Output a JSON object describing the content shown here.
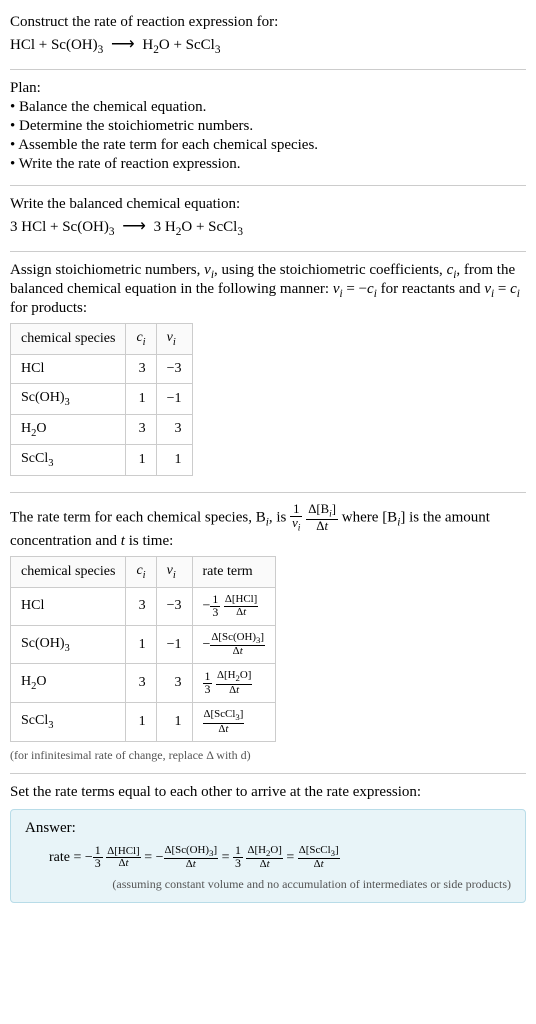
{
  "header": {
    "prompt": "Construct the rate of reaction expression for:",
    "equation": "HCl + Sc(OH)₃  ⟶  H₂O + ScCl₃"
  },
  "plan": {
    "title": "Plan:",
    "items": [
      "Balance the chemical equation.",
      "Determine the stoichiometric numbers.",
      "Assemble the rate term for each chemical species.",
      "Write the rate of reaction expression."
    ]
  },
  "balanced": {
    "prompt": "Write the balanced chemical equation:",
    "equation": "3 HCl + Sc(OH)₃  ⟶  3 H₂O + ScCl₃"
  },
  "stoich": {
    "intro_a": "Assign stoichiometric numbers, ",
    "intro_b": ", using the stoichiometric coefficients, ",
    "intro_c": ", from the balanced chemical equation in the following manner: ",
    "intro_d": " for reactants and ",
    "intro_e": " for products:",
    "headers": {
      "species": "chemical species",
      "ci": "cᵢ",
      "vi": "νᵢ"
    },
    "rows": [
      {
        "species": "HCl",
        "ci": "3",
        "vi": "−3"
      },
      {
        "species": "Sc(OH)₃",
        "ci": "1",
        "vi": "−1"
      },
      {
        "species": "H₂O",
        "ci": "3",
        "vi": "3"
      },
      {
        "species": "ScCl₃",
        "ci": "1",
        "vi": "1"
      }
    ]
  },
  "rateterm": {
    "intro_a": "The rate term for each chemical species, B",
    "intro_b": ", is ",
    "intro_c": " where [B",
    "intro_d": "] is the amount concentration and ",
    "intro_e": " is time:",
    "headers": {
      "species": "chemical species",
      "ci": "cᵢ",
      "vi": "νᵢ",
      "rate": "rate term"
    },
    "rows": [
      {
        "species": "HCl",
        "ci": "3",
        "vi": "−3",
        "coef_sign": "−",
        "coef_num": "1",
        "coef_den": "3",
        "conc": "Δ[HCl]"
      },
      {
        "species": "Sc(OH)₃",
        "ci": "1",
        "vi": "−1",
        "coef_sign": "−",
        "coef_num": "",
        "coef_den": "",
        "conc": "Δ[Sc(OH)3]"
      },
      {
        "species": "H₂O",
        "ci": "3",
        "vi": "3",
        "coef_sign": "",
        "coef_num": "1",
        "coef_den": "3",
        "conc": "Δ[H2O]"
      },
      {
        "species": "ScCl₃",
        "ci": "1",
        "vi": "1",
        "coef_sign": "",
        "coef_num": "",
        "coef_den": "",
        "conc": "Δ[ScCl3]"
      }
    ],
    "note": "(for infinitesimal rate of change, replace Δ with d)"
  },
  "final": {
    "intro": "Set the rate terms equal to each other to arrive at the rate expression:",
    "answer_label": "Answer:",
    "rate_eq": "rate = ",
    "note": "(assuming constant volume and no accumulation of intermediates or side products)"
  },
  "chart_data": {
    "type": "table",
    "title": "Stoichiometric numbers and rate terms",
    "tables": [
      {
        "columns": [
          "chemical species",
          "c_i",
          "ν_i"
        ],
        "rows": [
          [
            "HCl",
            3,
            -3
          ],
          [
            "Sc(OH)3",
            1,
            -1
          ],
          [
            "H2O",
            3,
            3
          ],
          [
            "ScCl3",
            1,
            1
          ]
        ]
      },
      {
        "columns": [
          "chemical species",
          "c_i",
          "ν_i",
          "rate term"
        ],
        "rows": [
          [
            "HCl",
            3,
            -3,
            "-(1/3)*Δ[HCl]/Δt"
          ],
          [
            "Sc(OH)3",
            1,
            -1,
            "-Δ[Sc(OH)3]/Δt"
          ],
          [
            "H2O",
            3,
            3,
            "(1/3)*Δ[H2O]/Δt"
          ],
          [
            "ScCl3",
            1,
            1,
            "Δ[ScCl3]/Δt"
          ]
        ]
      }
    ],
    "final_expression": "rate = -(1/3)Δ[HCl]/Δt = -Δ[Sc(OH)3]/Δt = (1/3)Δ[H2O]/Δt = Δ[ScCl3]/Δt"
  }
}
